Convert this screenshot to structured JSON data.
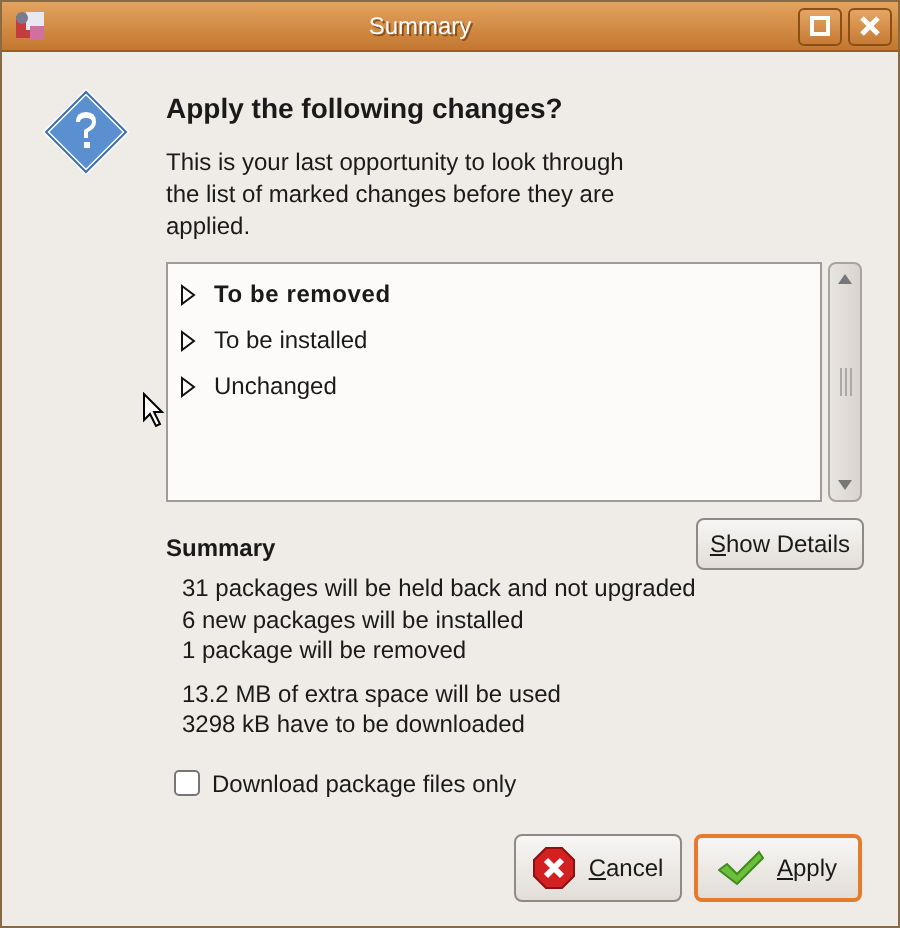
{
  "window": {
    "title": "Summary"
  },
  "heading": "Apply the following changes?",
  "message": "This is your last opportunity to look through the list of marked changes before they are applied.",
  "tree": [
    {
      "label": "To be removed",
      "bold": true,
      "expanded": false
    },
    {
      "label": "To be installed",
      "bold": false,
      "expanded": false
    },
    {
      "label": "Unchanged",
      "bold": false,
      "expanded": false
    }
  ],
  "summary": {
    "title": "Summary",
    "groups": [
      [
        "31 packages will be held back and not upgraded",
        "6 new packages will be installed",
        "1 package will be removed"
      ],
      [
        "13.2 MB of extra space will be used",
        "3298 kB have to be downloaded"
      ]
    ]
  },
  "details_button": {
    "label": "Show Details",
    "mnemonic_first": true
  },
  "download_only": {
    "label": "Download package files only",
    "checked": false
  },
  "buttons": [
    {
      "kind": "cancel",
      "label": "Cancel",
      "mnemonic_first": true,
      "default": false
    },
    {
      "kind": "apply",
      "label": "Apply",
      "mnemonic_first": true,
      "default": true
    }
  ]
}
